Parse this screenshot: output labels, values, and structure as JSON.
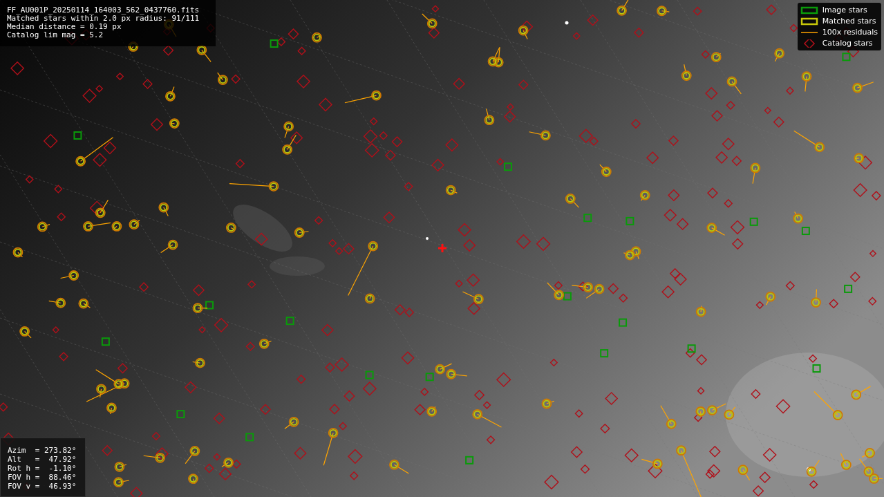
{
  "info": {
    "lines": [
      "FF_AU001P_20250114_164003_562_0437760.fits",
      "Matched stars within 2.0 px radius: 91/111",
      "Median distance = 0.19 px",
      "Catalog lim mag = 5.2"
    ]
  },
  "legend": {
    "items": [
      {
        "kind": "image",
        "label": "Image stars"
      },
      {
        "kind": "matched",
        "label": "Matched stars"
      },
      {
        "kind": "residual",
        "label": "100x residuals"
      },
      {
        "kind": "catalog",
        "label": "Catalog stars"
      }
    ]
  },
  "pointing": {
    "lines": [
      "Azim  = 273.82°",
      "Alt   =  47.92°",
      "Rot h =  -1.10°",
      "FOV h =  88.46°",
      "FOV v =  46.93°"
    ]
  }
}
